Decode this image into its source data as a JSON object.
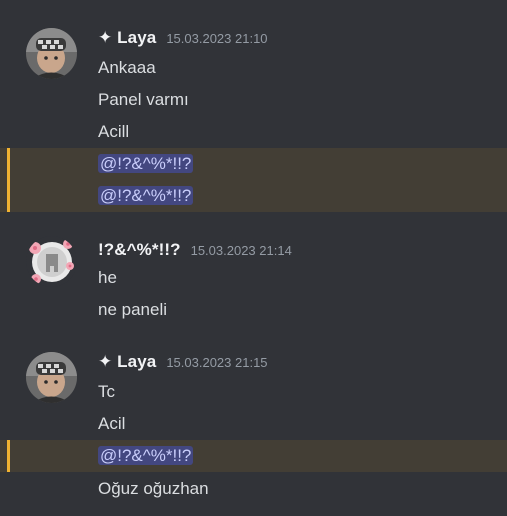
{
  "messages": [
    {
      "username": "✦ Laya",
      "timestamp": "15.03.2023 21:10",
      "lines": [
        "Ankaaa",
        "Panel varmı",
        "Acill"
      ],
      "mentions": [
        "@!?&^%*!!?",
        "@!?&^%*!!?"
      ]
    },
    {
      "username": "!?&^%*!!?",
      "timestamp": "15.03.2023 21:14",
      "lines": [
        "he",
        "ne paneli"
      ]
    },
    {
      "username": "✦ Laya",
      "timestamp": "15.03.2023 21:15",
      "lines": [
        "Tc",
        "Acil"
      ],
      "mentions": [
        "@!?&^%*!!?"
      ],
      "after": "Oğuz oğuzhan"
    }
  ],
  "colors": {
    "background": "#313338",
    "mention_highlight_bg": "#433e35",
    "mention_highlight_bar": "#f0b232",
    "mention_pill_bg": "#434780",
    "mention_pill_text": "#c9cdfb"
  }
}
